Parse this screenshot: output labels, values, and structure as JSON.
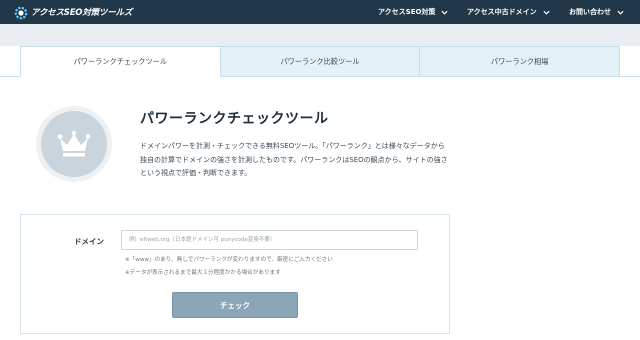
{
  "header": {
    "logo_text": "アクセスSEO対策ツールズ",
    "nav": [
      {
        "label": "アクセスSEO対策"
      },
      {
        "label": "アクセス中古ドメイン"
      },
      {
        "label": "お問い合わせ"
      }
    ]
  },
  "tabs": [
    {
      "label": "パワーランクチェックツール",
      "active": true
    },
    {
      "label": "パワーランク比較ツール",
      "active": false
    },
    {
      "label": "パワーランク相場",
      "active": false
    }
  ],
  "main": {
    "icon": "crown-icon",
    "title": "パワーランクチェックツール",
    "description": "ドメインパワーを計測・チェックできる無料SEOツール。「パワーランク」とは様々なデータから独自の計算でドメインの強さを計測したものです。パワーランクはSEOの観点から、サイトの強さという視点で評価・判断できます。"
  },
  "form": {
    "domain_label": "ドメイン",
    "domain_value": "",
    "domain_placeholder": "例）eftweb.org（日本語ドメイン可 punycode変換不要）",
    "note1": "※「www」のあり、無しでパワーランクが変わりますので、厳密にご入力ください",
    "note2": "※データが表示されるまで最大１分程度かかる場合があります",
    "submit_label": "チェック"
  },
  "colors": {
    "header_bg": "#20384a",
    "tab_inactive_bg": "#e3f1f9",
    "button_bg": "#8aa6b7",
    "crown_circle": "#c9d4dc"
  }
}
